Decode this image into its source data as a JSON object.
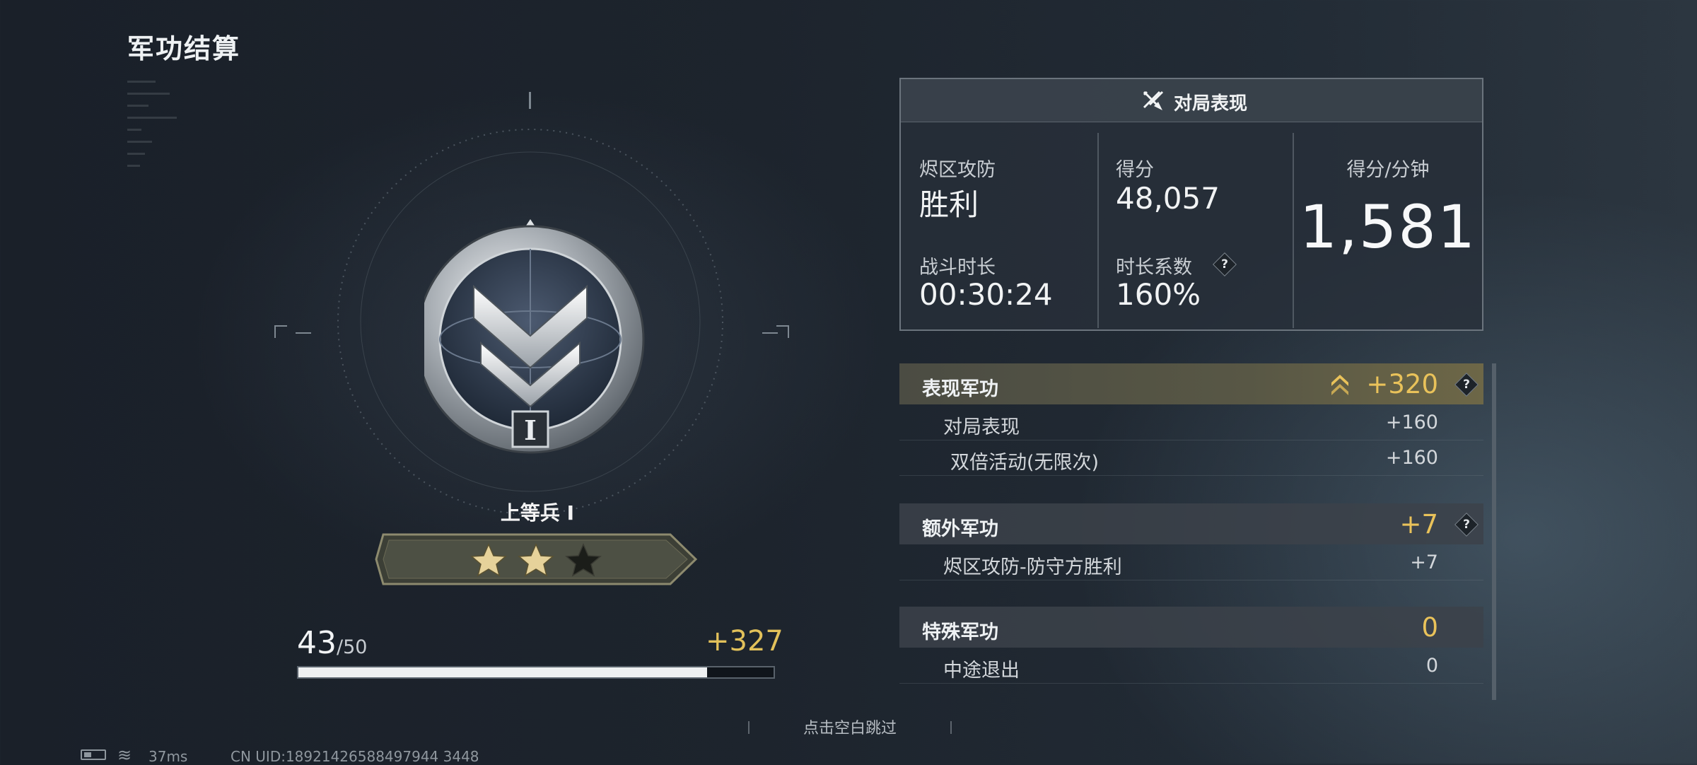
{
  "title": "军功结算",
  "rank": {
    "name": "上等兵 I",
    "badge_numeral": "I",
    "stars_filled": 2,
    "stars_total": 3
  },
  "progress": {
    "current": "43",
    "max": "/50",
    "gain": "+327",
    "fraction": 0.86
  },
  "skip_hint": "点击空白跳过",
  "footer": {
    "ping": "37ms",
    "uid": "CN UID:18921426588497944 3448"
  },
  "performance": {
    "header": "对局表现",
    "mode_label": "烬区攻防",
    "mode_value": "胜利",
    "score_label": "得分",
    "score_value": "48,057",
    "time_label": "战斗时长",
    "time_value": "00:30:24",
    "coef_label": "时长系数",
    "coef_value": "160%",
    "spm_label": "得分/分钟",
    "spm_value": "1,581"
  },
  "merits": {
    "performance": {
      "title": "表现军功",
      "value": "+320",
      "items": [
        {
          "label": "对局表现",
          "value": "+160"
        },
        {
          "label": "双倍活动(无限次)",
          "value": "+160"
        }
      ]
    },
    "extra": {
      "title": "额外军功",
      "value": "+7",
      "items": [
        {
          "label": "烬区攻防-防守方胜利",
          "value": "+7"
        }
      ]
    },
    "special": {
      "title": "特殊军功",
      "value": "0",
      "items": [
        {
          "label": "中途退出",
          "value": "0"
        }
      ]
    }
  },
  "help_mark": "?",
  "colors": {
    "accent_gold": "#e9c25a",
    "panel_bg": "#28303a"
  }
}
